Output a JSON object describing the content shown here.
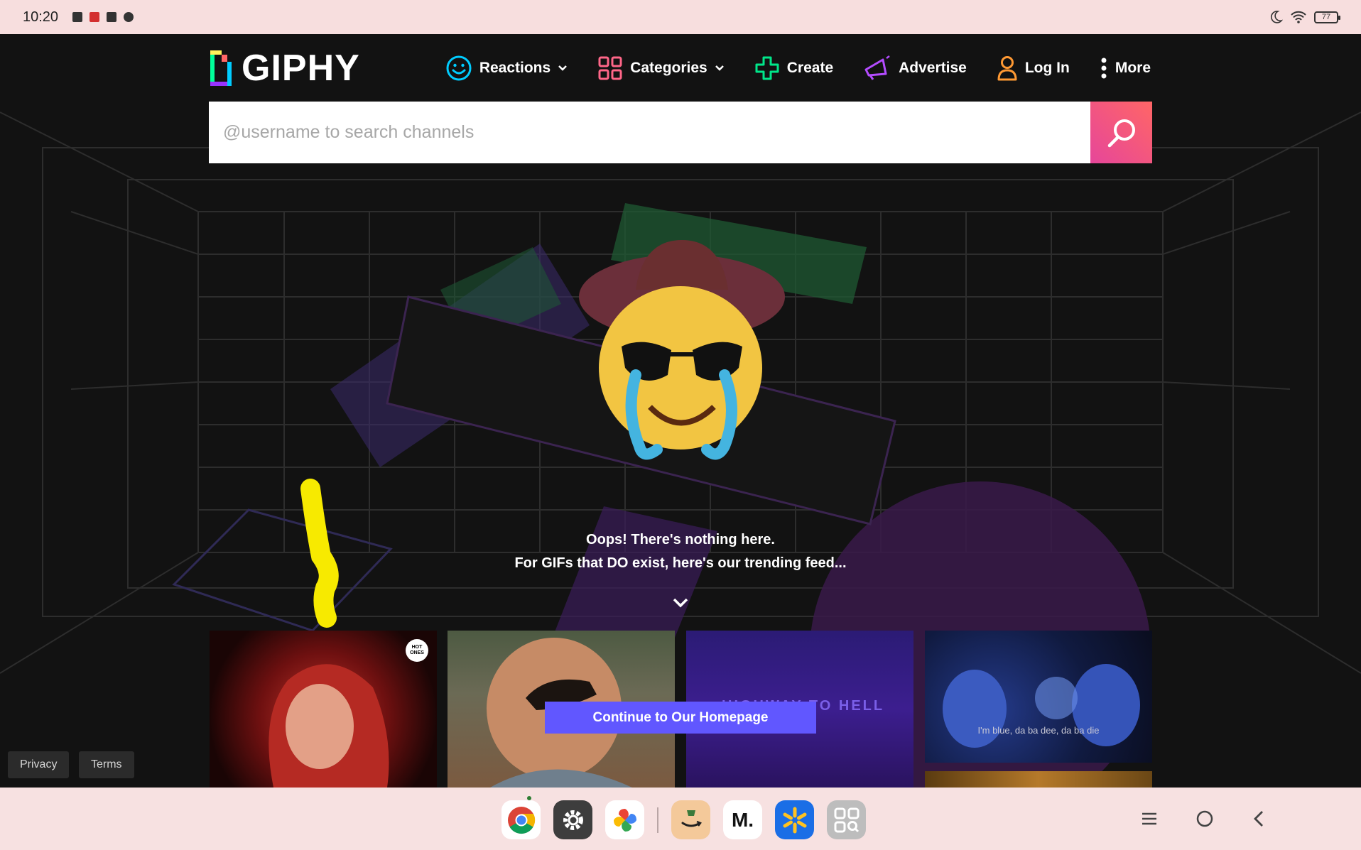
{
  "status_bar": {
    "time": "10:20",
    "battery": "77"
  },
  "header": {
    "logo_text": "GIPHY",
    "nav": [
      {
        "label": "Reactions",
        "icon": "smiley-icon",
        "has_dropdown": true
      },
      {
        "label": "Categories",
        "icon": "grid-icon",
        "has_dropdown": true
      },
      {
        "label": "Create",
        "icon": "plus-icon",
        "has_dropdown": false
      },
      {
        "label": "Advertise",
        "icon": "megaphone-icon",
        "has_dropdown": false
      },
      {
        "label": "Log In",
        "icon": "user-icon",
        "has_dropdown": false
      },
      {
        "label": "More",
        "icon": "dots-vertical-icon",
        "has_dropdown": false
      }
    ]
  },
  "search": {
    "placeholder": "@username to search channels",
    "value": ""
  },
  "hero": {
    "line1": "Oops! There's nothing here.",
    "line2": "For GIFs that DO exist, here's our trending feed..."
  },
  "gifs": {
    "gif3_text": "HIGHWAY TO HELL",
    "gif4_caption": "I'm blue, da ba dee, da ba die"
  },
  "cta_label": "Continue to Our Homepage",
  "footer": {
    "privacy": "Privacy",
    "terms": "Terms"
  },
  "dock": {
    "apps": [
      "chrome",
      "settings",
      "photos",
      "amazon",
      "medium",
      "walmart",
      "app-drawer"
    ],
    "medium_label": "M."
  },
  "colors": {
    "accent_cta": "#6157ff",
    "search_button": "#e6469a",
    "status_bar_bg": "#f7dede"
  }
}
